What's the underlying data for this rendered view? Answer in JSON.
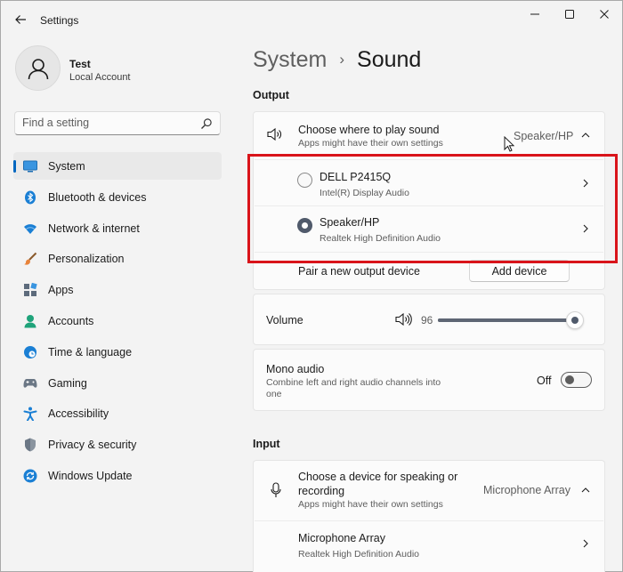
{
  "window": {
    "title": "Settings",
    "controls": [
      "minimize",
      "maximize",
      "close"
    ]
  },
  "profile": {
    "name": "Test",
    "account_type": "Local Account"
  },
  "search": {
    "placeholder": "Find a setting",
    "value": ""
  },
  "sidebar": {
    "items": [
      {
        "label": "System",
        "icon": "system-icon",
        "active": true
      },
      {
        "label": "Bluetooth & devices",
        "icon": "bluetooth-icon"
      },
      {
        "label": "Network & internet",
        "icon": "wifi-icon"
      },
      {
        "label": "Personalization",
        "icon": "brush-icon"
      },
      {
        "label": "Apps",
        "icon": "apps-icon"
      },
      {
        "label": "Accounts",
        "icon": "accounts-icon"
      },
      {
        "label": "Time & language",
        "icon": "globe-clock-icon"
      },
      {
        "label": "Gaming",
        "icon": "gamepad-icon"
      },
      {
        "label": "Accessibility",
        "icon": "accessibility-icon"
      },
      {
        "label": "Privacy & security",
        "icon": "shield-icon"
      },
      {
        "label": "Windows Update",
        "icon": "update-icon"
      }
    ]
  },
  "breadcrumb": {
    "parent": "System",
    "separator": "›",
    "current": "Sound"
  },
  "output": {
    "section_label": "Output",
    "choose": {
      "title": "Choose where to play sound",
      "subtitle": "Apps might have their own settings",
      "selected": "Speaker/HP"
    },
    "devices": [
      {
        "name": "DELL P2415Q",
        "driver": "Intel(R) Display Audio",
        "selected": false
      },
      {
        "name": "Speaker/HP",
        "driver": "Realtek High Definition Audio",
        "selected": true
      }
    ],
    "pair": {
      "label": "Pair a new output device",
      "button": "Add device"
    },
    "volume": {
      "label": "Volume",
      "value": "96",
      "level": 0.96
    },
    "mono": {
      "title": "Mono audio",
      "subtitle_line1": "Combine left and right audio channels into",
      "subtitle_line2": "one",
      "state": "Off"
    }
  },
  "input": {
    "section_label": "Input",
    "choose": {
      "title_line1": "Choose a device for speaking or",
      "title_line2": "recording",
      "subtitle": "Apps might have their own settings",
      "selected": "Microphone Array"
    },
    "devices": [
      {
        "name": "Microphone Array",
        "driver": "Realtek High Definition Audio"
      }
    ]
  },
  "colors": {
    "accent": "#0067c0",
    "highlight_box": "#d9141a",
    "slider": "#505a6b"
  }
}
